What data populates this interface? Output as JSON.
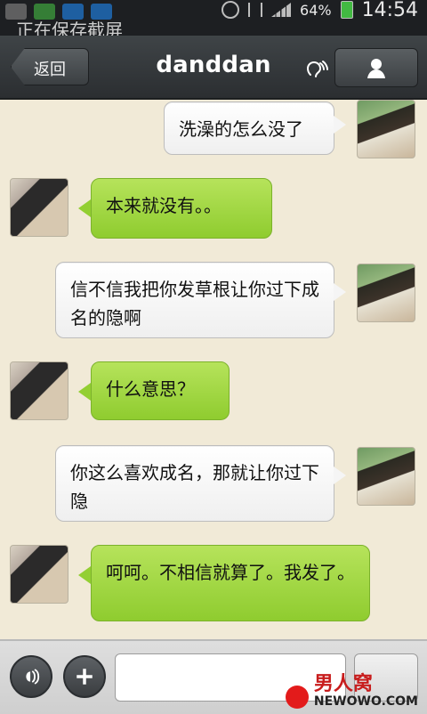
{
  "statusbar": {
    "notification": "正在保存截屏",
    "battery_percent": "64%",
    "time": "14:54"
  },
  "header": {
    "back_label": "返回",
    "title": "danddan"
  },
  "messages": [
    {
      "side": "right",
      "text": "洗澡的怎么没了"
    },
    {
      "side": "left",
      "text": "本来就没有。。"
    },
    {
      "side": "right",
      "text": "信不信我把你发草根让你过下成名的隐啊"
    },
    {
      "side": "left",
      "text": "什么意思？"
    },
    {
      "side": "right",
      "text": "你这么喜欢成名，那就让你过下隐"
    },
    {
      "side": "left",
      "text": "呵呵。不相信就算了。我发了。"
    }
  ],
  "watermark": {
    "brand": "男人窝",
    "site": "NEWOWO.COM"
  }
}
